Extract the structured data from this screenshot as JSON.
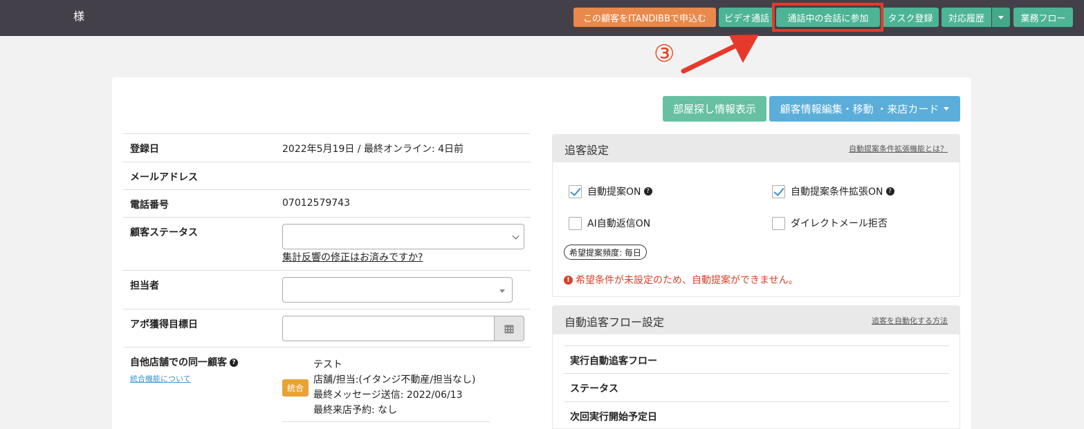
{
  "header": {
    "customer_suffix": "様",
    "buttons": {
      "apply_itandi": "この顧客をITANDIBBで申込む",
      "video_call": "ビデオ通話",
      "join_call": "通話中の会話に参加",
      "task_register": "タスク登録",
      "history": "対応履歴",
      "workflow": "業務フロー"
    }
  },
  "annotation": {
    "step": "③",
    "color": "#e53a2b"
  },
  "actions": {
    "room_search": "部屋探し情報表示",
    "edit_customer": "顧客情報編集・移動 ・来店カード"
  },
  "customer_info": {
    "registered_label": "登録日",
    "registered_value": "2022年5月19日 / 最終オンライン: 4日前",
    "email_label": "メールアドレス",
    "email_value": "",
    "phone_label": "電話番号",
    "phone_value": "07012579743",
    "status_label": "顧客ステータス",
    "status_value": "",
    "status_link": "集計反響の修正はお済みですか?",
    "staff_label": "担当者",
    "staff_value": "",
    "appointment_label": "アポ獲得目標日",
    "appointment_value": "",
    "same_customer_label": "自他店舗での同一顧客",
    "merge_link": "統合機能について",
    "merge_badge": "統合",
    "same_customer": {
      "name": "テスト",
      "store": "店舗/担当:(イタンジ不動産/担当なし)",
      "last_message": "最終メッセージ送信: 2022/06/13",
      "last_visit": "最終来店予約: なし"
    }
  },
  "follow_settings": {
    "title": "追客設定",
    "help_link": "自動提案条件拡張機能とは？",
    "auto_suggest": "自動提案ON",
    "auto_suggest_ext": "自動提案条件拡張ON",
    "ai_reply": "AI自動返信ON",
    "direct_mail_reject": "ダイレクトメール拒否",
    "frequency": "希望提案頻度: 毎日",
    "warning": "希望条件が未設定のため、自動提案ができません。"
  },
  "auto_flow": {
    "title": "自動追客フロー設定",
    "help_link": "追客を自動化する方法",
    "row1": "実行自動追客フロー",
    "row2": "ステータス",
    "row3": "次回実行開始予定日"
  },
  "colors": {
    "topbar": "#434049",
    "orange": "#e9894c",
    "green": "#4db495",
    "blue": "#5aaed9",
    "warning": "#d9412a",
    "badge": "#e9a236"
  }
}
